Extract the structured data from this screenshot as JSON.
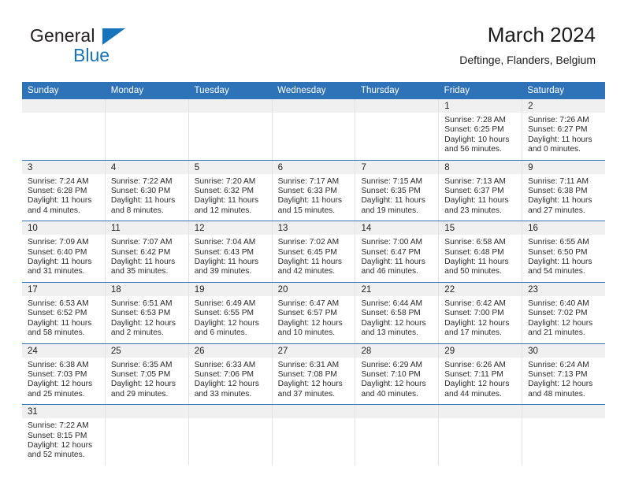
{
  "brand": {
    "name_top": "General",
    "name_bottom": "Blue",
    "triangle_color": "#1574bb",
    "top_color": "#231f20"
  },
  "header": {
    "title": "March 2024",
    "subtitle": "Deftinge, Flanders, Belgium"
  },
  "theme": {
    "header_blue": "#2e72b8",
    "date_strip": "#f0f0f0",
    "grid_line": "#e2e2e2"
  },
  "weekdays": [
    "Sunday",
    "Monday",
    "Tuesday",
    "Wednesday",
    "Thursday",
    "Friday",
    "Saturday"
  ],
  "labels": {
    "sunrise": "Sunrise:",
    "sunset": "Sunset:",
    "daylight": "Daylight:"
  },
  "weeks": [
    [
      {
        "blank": true
      },
      {
        "blank": true
      },
      {
        "blank": true
      },
      {
        "blank": true
      },
      {
        "blank": true
      },
      {
        "date": "1",
        "sunrise": "Sunrise: 7:28 AM",
        "sunset": "Sunset: 6:25 PM",
        "daylight1": "Daylight: 10 hours",
        "daylight2": "and 56 minutes."
      },
      {
        "date": "2",
        "sunrise": "Sunrise: 7:26 AM",
        "sunset": "Sunset: 6:27 PM",
        "daylight1": "Daylight: 11 hours",
        "daylight2": "and 0 minutes."
      }
    ],
    [
      {
        "date": "3",
        "sunrise": "Sunrise: 7:24 AM",
        "sunset": "Sunset: 6:28 PM",
        "daylight1": "Daylight: 11 hours",
        "daylight2": "and 4 minutes."
      },
      {
        "date": "4",
        "sunrise": "Sunrise: 7:22 AM",
        "sunset": "Sunset: 6:30 PM",
        "daylight1": "Daylight: 11 hours",
        "daylight2": "and 8 minutes."
      },
      {
        "date": "5",
        "sunrise": "Sunrise: 7:20 AM",
        "sunset": "Sunset: 6:32 PM",
        "daylight1": "Daylight: 11 hours",
        "daylight2": "and 12 minutes."
      },
      {
        "date": "6",
        "sunrise": "Sunrise: 7:17 AM",
        "sunset": "Sunset: 6:33 PM",
        "daylight1": "Daylight: 11 hours",
        "daylight2": "and 15 minutes."
      },
      {
        "date": "7",
        "sunrise": "Sunrise: 7:15 AM",
        "sunset": "Sunset: 6:35 PM",
        "daylight1": "Daylight: 11 hours",
        "daylight2": "and 19 minutes."
      },
      {
        "date": "8",
        "sunrise": "Sunrise: 7:13 AM",
        "sunset": "Sunset: 6:37 PM",
        "daylight1": "Daylight: 11 hours",
        "daylight2": "and 23 minutes."
      },
      {
        "date": "9",
        "sunrise": "Sunrise: 7:11 AM",
        "sunset": "Sunset: 6:38 PM",
        "daylight1": "Daylight: 11 hours",
        "daylight2": "and 27 minutes."
      }
    ],
    [
      {
        "date": "10",
        "sunrise": "Sunrise: 7:09 AM",
        "sunset": "Sunset: 6:40 PM",
        "daylight1": "Daylight: 11 hours",
        "daylight2": "and 31 minutes."
      },
      {
        "date": "11",
        "sunrise": "Sunrise: 7:07 AM",
        "sunset": "Sunset: 6:42 PM",
        "daylight1": "Daylight: 11 hours",
        "daylight2": "and 35 minutes."
      },
      {
        "date": "12",
        "sunrise": "Sunrise: 7:04 AM",
        "sunset": "Sunset: 6:43 PM",
        "daylight1": "Daylight: 11 hours",
        "daylight2": "and 39 minutes."
      },
      {
        "date": "13",
        "sunrise": "Sunrise: 7:02 AM",
        "sunset": "Sunset: 6:45 PM",
        "daylight1": "Daylight: 11 hours",
        "daylight2": "and 42 minutes."
      },
      {
        "date": "14",
        "sunrise": "Sunrise: 7:00 AM",
        "sunset": "Sunset: 6:47 PM",
        "daylight1": "Daylight: 11 hours",
        "daylight2": "and 46 minutes."
      },
      {
        "date": "15",
        "sunrise": "Sunrise: 6:58 AM",
        "sunset": "Sunset: 6:48 PM",
        "daylight1": "Daylight: 11 hours",
        "daylight2": "and 50 minutes."
      },
      {
        "date": "16",
        "sunrise": "Sunrise: 6:55 AM",
        "sunset": "Sunset: 6:50 PM",
        "daylight1": "Daylight: 11 hours",
        "daylight2": "and 54 minutes."
      }
    ],
    [
      {
        "date": "17",
        "sunrise": "Sunrise: 6:53 AM",
        "sunset": "Sunset: 6:52 PM",
        "daylight1": "Daylight: 11 hours",
        "daylight2": "and 58 minutes."
      },
      {
        "date": "18",
        "sunrise": "Sunrise: 6:51 AM",
        "sunset": "Sunset: 6:53 PM",
        "daylight1": "Daylight: 12 hours",
        "daylight2": "and 2 minutes."
      },
      {
        "date": "19",
        "sunrise": "Sunrise: 6:49 AM",
        "sunset": "Sunset: 6:55 PM",
        "daylight1": "Daylight: 12 hours",
        "daylight2": "and 6 minutes."
      },
      {
        "date": "20",
        "sunrise": "Sunrise: 6:47 AM",
        "sunset": "Sunset: 6:57 PM",
        "daylight1": "Daylight: 12 hours",
        "daylight2": "and 10 minutes."
      },
      {
        "date": "21",
        "sunrise": "Sunrise: 6:44 AM",
        "sunset": "Sunset: 6:58 PM",
        "daylight1": "Daylight: 12 hours",
        "daylight2": "and 13 minutes."
      },
      {
        "date": "22",
        "sunrise": "Sunrise: 6:42 AM",
        "sunset": "Sunset: 7:00 PM",
        "daylight1": "Daylight: 12 hours",
        "daylight2": "and 17 minutes."
      },
      {
        "date": "23",
        "sunrise": "Sunrise: 6:40 AM",
        "sunset": "Sunset: 7:02 PM",
        "daylight1": "Daylight: 12 hours",
        "daylight2": "and 21 minutes."
      }
    ],
    [
      {
        "date": "24",
        "sunrise": "Sunrise: 6:38 AM",
        "sunset": "Sunset: 7:03 PM",
        "daylight1": "Daylight: 12 hours",
        "daylight2": "and 25 minutes."
      },
      {
        "date": "25",
        "sunrise": "Sunrise: 6:35 AM",
        "sunset": "Sunset: 7:05 PM",
        "daylight1": "Daylight: 12 hours",
        "daylight2": "and 29 minutes."
      },
      {
        "date": "26",
        "sunrise": "Sunrise: 6:33 AM",
        "sunset": "Sunset: 7:06 PM",
        "daylight1": "Daylight: 12 hours",
        "daylight2": "and 33 minutes."
      },
      {
        "date": "27",
        "sunrise": "Sunrise: 6:31 AM",
        "sunset": "Sunset: 7:08 PM",
        "daylight1": "Daylight: 12 hours",
        "daylight2": "and 37 minutes."
      },
      {
        "date": "28",
        "sunrise": "Sunrise: 6:29 AM",
        "sunset": "Sunset: 7:10 PM",
        "daylight1": "Daylight: 12 hours",
        "daylight2": "and 40 minutes."
      },
      {
        "date": "29",
        "sunrise": "Sunrise: 6:26 AM",
        "sunset": "Sunset: 7:11 PM",
        "daylight1": "Daylight: 12 hours",
        "daylight2": "and 44 minutes."
      },
      {
        "date": "30",
        "sunrise": "Sunrise: 6:24 AM",
        "sunset": "Sunset: 7:13 PM",
        "daylight1": "Daylight: 12 hours",
        "daylight2": "and 48 minutes."
      }
    ],
    [
      {
        "date": "31",
        "sunrise": "Sunrise: 7:22 AM",
        "sunset": "Sunset: 8:15 PM",
        "daylight1": "Daylight: 12 hours",
        "daylight2": "and 52 minutes."
      },
      {
        "blank": true
      },
      {
        "blank": true
      },
      {
        "blank": true
      },
      {
        "blank": true
      },
      {
        "blank": true
      },
      {
        "blank": true
      }
    ]
  ]
}
